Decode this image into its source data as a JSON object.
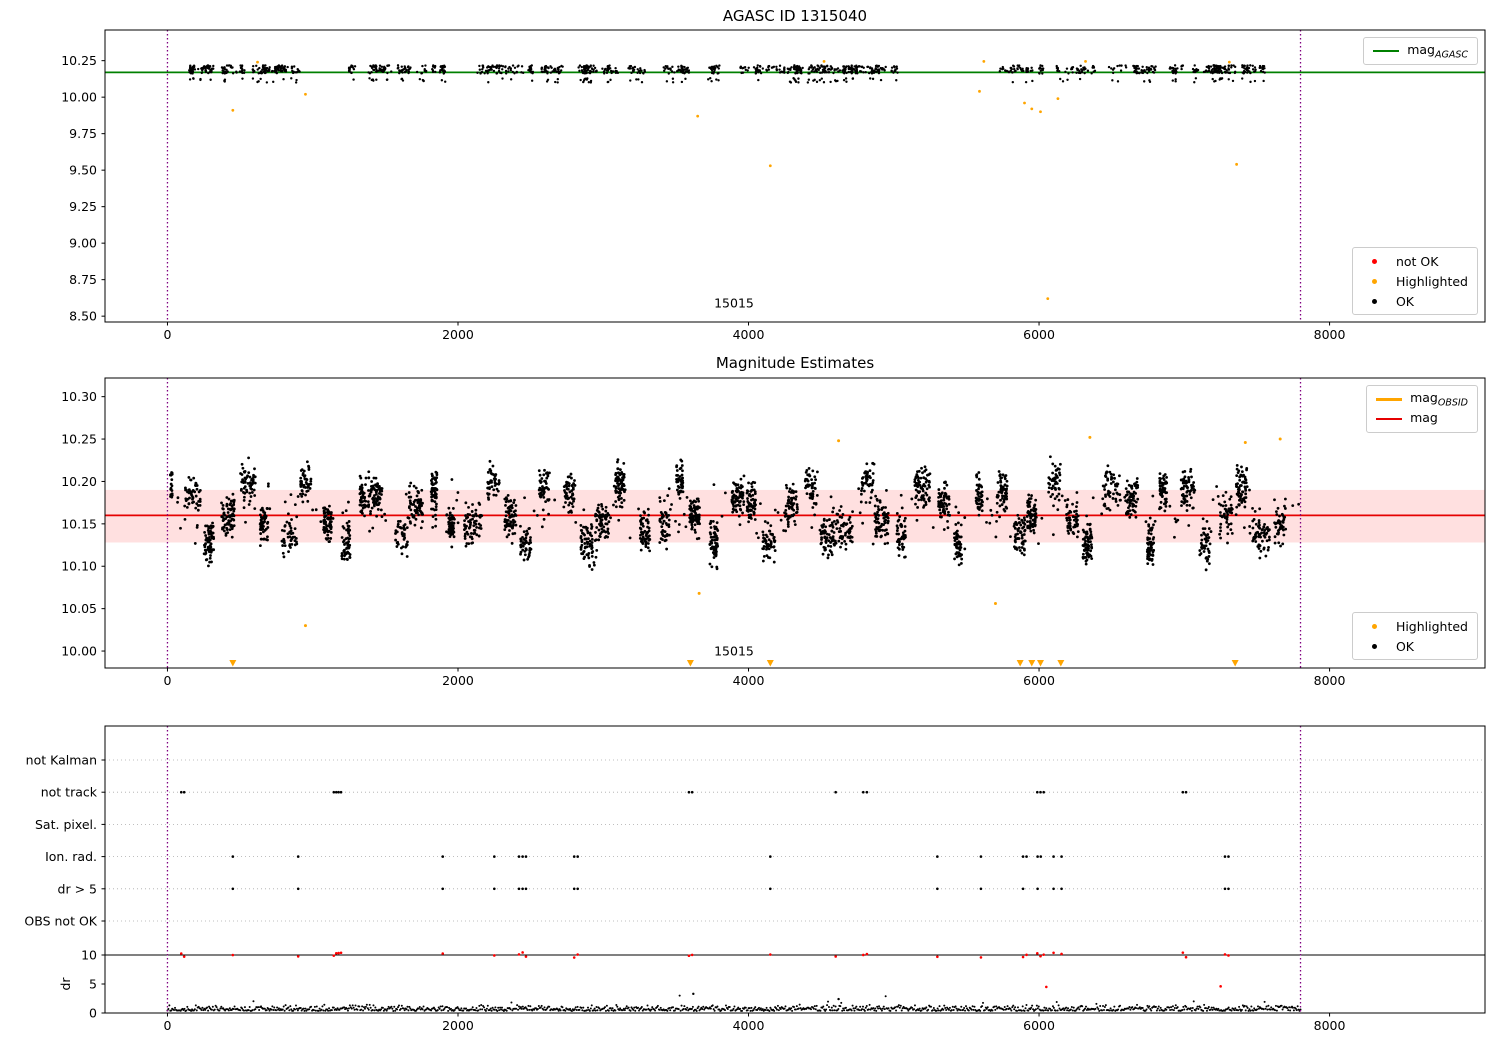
{
  "colors": {
    "ok": "#000000",
    "not_ok": "#ff0000",
    "highlighted": "#ffa500",
    "agasc_line": "#008000",
    "mag_line": "#e60000",
    "mag_band": "#ff0000",
    "obsid_line": "#ffa500",
    "vline": "#800080",
    "grid": "#aaaaaa",
    "text": "#000000"
  },
  "panels": {
    "top": {
      "title": "AGASC ID 1315040",
      "legend_line": {
        "main": "mag",
        "sub": "AGASC",
        "color_key": "agasc_line"
      },
      "legend_markers": [
        {
          "label": "not OK",
          "color_key": "not_ok"
        },
        {
          "label": "Highlighted",
          "color_key": "highlighted"
        },
        {
          "label": "OK",
          "color_key": "ok"
        }
      ]
    },
    "middle": {
      "title": "Magnitude Estimates",
      "legend_lines": [
        {
          "main": "mag",
          "sub": "OBSID",
          "color_key": "obsid_line"
        },
        {
          "main": "mag",
          "sub": "",
          "color_key": "mag_line"
        }
      ],
      "legend_markers": [
        {
          "label": "Highlighted",
          "color_key": "highlighted"
        },
        {
          "label": "OK",
          "color_key": "ok"
        }
      ]
    },
    "bottom": {
      "categories": [
        "not Kalman",
        "not track",
        "Sat. pixel.",
        "Ion. rad.",
        "dr > 5",
        "OBS not OK"
      ],
      "dr_label": "dr"
    }
  },
  "chart_data": [
    {
      "panel": "top",
      "type": "scatter",
      "title": "AGASC ID 1315040",
      "xlim": [
        -430,
        9070
      ],
      "ylim": [
        8.46,
        10.46
      ],
      "xticks": [
        0,
        2000,
        4000,
        6000,
        8000
      ],
      "yticks": [
        8.5,
        8.75,
        9.0,
        9.25,
        9.5,
        9.75,
        10.0,
        10.25
      ],
      "mag_agasc_line": 10.17,
      "vlines": [
        0,
        7800
      ],
      "annotation": {
        "text": "15015",
        "x": 3900,
        "y": 8.56
      },
      "ok_scatter": {
        "x_min": 20,
        "x_max": 7790,
        "n_clusters": 90,
        "points_per_cluster": 15,
        "y_center": 10.19,
        "y_spread": 0.028,
        "low_band_center": 10.115,
        "low_band_spread": 0.015,
        "low_band_frac": 0.1,
        "seed": 42
      },
      "not_ok_points": [],
      "highlighted_points": [
        [
          450,
          9.91
        ],
        [
          620,
          10.24
        ],
        [
          950,
          10.02
        ],
        [
          3650,
          9.87
        ],
        [
          4150,
          9.53
        ],
        [
          4520,
          10.245
        ],
        [
          5590,
          10.04
        ],
        [
          5620,
          10.245
        ],
        [
          5900,
          9.96
        ],
        [
          5950,
          9.92
        ],
        [
          6010,
          9.9
        ],
        [
          6060,
          8.62
        ],
        [
          6130,
          9.99
        ],
        [
          6320,
          10.245
        ],
        [
          7310,
          10.24
        ],
        [
          7360,
          9.54
        ]
      ]
    },
    {
      "panel": "middle",
      "type": "scatter",
      "title": "Magnitude Estimates",
      "xlim": [
        -430,
        9070
      ],
      "ylim": [
        9.98,
        10.322
      ],
      "xticks": [
        0,
        2000,
        4000,
        6000,
        8000
      ],
      "yticks": [
        10.0,
        10.05,
        10.1,
        10.15,
        10.2,
        10.25,
        10.3
      ],
      "mag_line": 10.16,
      "mag_band": [
        10.128,
        10.19
      ],
      "vlines": [
        0,
        7800
      ],
      "annotation": {
        "text": "15015",
        "x": 3900,
        "y": 9.995
      },
      "ok_scatter": {
        "x_min": 20,
        "x_max": 7790,
        "n_clusters": 60,
        "cluster_spacing": 129,
        "y_center": 10.163,
        "wave_amp": 0.038,
        "y_sigma": 0.035,
        "y_min": 10.088,
        "y_max": 10.246,
        "seed": 7
      },
      "highlighted_points": [
        [
          950,
          10.03
        ],
        [
          3660,
          10.068
        ],
        [
          4620,
          10.248
        ],
        [
          5700,
          10.056
        ],
        [
          6350,
          10.252
        ],
        [
          7420,
          10.246
        ],
        [
          7660,
          10.25
        ]
      ],
      "off_scale_low_x": [
        450,
        3600,
        4150,
        5870,
        5950,
        6010,
        6150,
        7350
      ]
    },
    {
      "panel": "bottom",
      "type": "flags",
      "xlim": [
        -430,
        9070
      ],
      "xticks": [
        0,
        2000,
        4000,
        6000,
        8000
      ],
      "vlines": [
        0,
        7800
      ],
      "categories": [
        "not Kalman",
        "not track",
        "Sat. pixel.",
        "Ion. rad.",
        "dr > 5",
        "OBS not OK"
      ],
      "flag_rows": {
        "not Kalman": [],
        "not track": [
          95,
          115,
          1145,
          1162,
          1178,
          1195,
          3590,
          3612,
          4600,
          4790,
          4815,
          5988,
          6010,
          6032,
          6990,
          7012
        ],
        "Sat. pixel.": [],
        "Ion. rad.": [
          450,
          900,
          1895,
          2250,
          2420,
          2445,
          2468,
          2800,
          2824,
          4150,
          5300,
          5600,
          5890,
          5914,
          5990,
          6012,
          6100,
          6155,
          7280,
          7304
        ],
        "dr > 5": [
          450,
          900,
          1895,
          2250,
          2420,
          2445,
          2468,
          2800,
          2824,
          4150,
          5300,
          5600,
          5890,
          5990,
          6100,
          6155,
          7280,
          7304
        ],
        "OBS not OK": []
      },
      "dr_axis": {
        "label": "dr",
        "ticks": [
          0,
          5,
          10
        ],
        "hline": 10,
        "red_at_limit_x": [
          95,
          115,
          450,
          900,
          1145,
          1162,
          1178,
          1195,
          1895,
          2250,
          2420,
          2445,
          2468,
          2800,
          2824,
          3590,
          3612,
          4150,
          4600,
          4790,
          4815,
          5300,
          5600,
          5890,
          5914,
          5988,
          6010,
          6032,
          6100,
          6155,
          6990,
          7012,
          7280,
          7304
        ],
        "red_below_points": [
          [
            6050,
            4.5
          ],
          [
            7250,
            4.6
          ]
        ],
        "black_outlier_points": [
          [
            3620,
            3.3
          ],
          [
            4620,
            2.4
          ]
        ],
        "trace": {
          "x_min": 0,
          "x_max": 7800,
          "n": 1200,
          "base": 0.35,
          "spread": 1.1,
          "seed": 99
        }
      }
    }
  ]
}
